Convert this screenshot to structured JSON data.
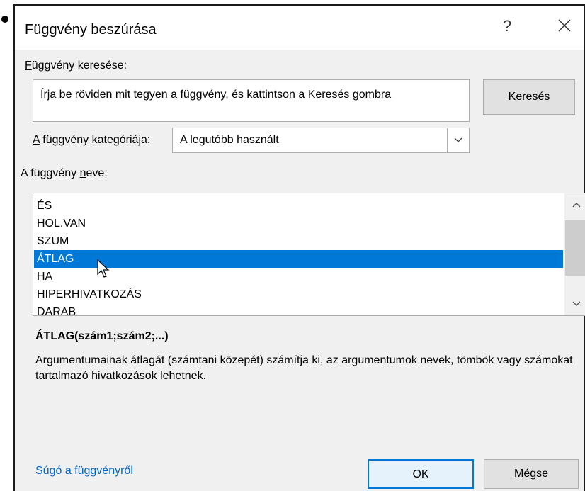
{
  "dialog": {
    "title": "Függvény beszúrása",
    "help": "?",
    "close_icon": "close-icon"
  },
  "search": {
    "label_accel": "F",
    "label_rest": "üggvény keresése:",
    "text": "Írja be röviden mit tegyen a függvény, és kattintson a Keresés gombra",
    "button_accel": "K",
    "button_rest": "eresés"
  },
  "category": {
    "label_accel": "A",
    "label_rest": " függvény kategóriája:",
    "selected": "A legutóbb használt"
  },
  "function_list": {
    "label_pre": "A függvény ",
    "label_accel": "n",
    "label_post": "eve:",
    "items": [
      "ÉS",
      "HOL.VAN",
      "SZUM",
      "ÁTLAG",
      "HA",
      "HIPERHIVATKOZÁS",
      "DARAB"
    ],
    "selected_index": 3
  },
  "details": {
    "signature": "ÁTLAG(szám1;szám2;...)",
    "description": "Argumentumainak átlagát (számtani közepét) számítja ki, az argumentumok nevek, tömbök vagy számokat tartalmazó hivatkozások lehetnek."
  },
  "footer": {
    "help_link": "Súgó a függvényről",
    "ok": "OK",
    "cancel": "Mégse"
  },
  "colors": {
    "selection": "#0078d7",
    "link": "#0066cc",
    "dialog_bg": "#f0f0f0"
  }
}
